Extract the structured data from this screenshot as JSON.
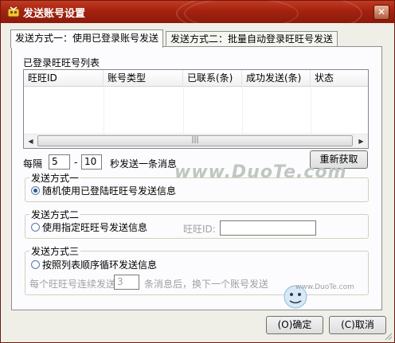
{
  "window": {
    "title": "发送账号设置",
    "close_symbol": "✕"
  },
  "tabs": [
    {
      "label": "发送方式一：使用已登录账号发送",
      "active": true
    },
    {
      "label": "发送方式二：批量自动登录旺旺号发送",
      "active": false
    }
  ],
  "logged_list": {
    "label": "已登录旺旺号列表",
    "columns": [
      "旺旺ID",
      "账号类型",
      "已联系(条)",
      "成功发送(条)",
      "状态"
    ],
    "rows": [],
    "scroll_left": "◀",
    "scroll_right": "▶",
    "thumb_grip": "|||"
  },
  "interval": {
    "prefix": "每隔",
    "from_value": "5",
    "dash": "-",
    "to_value": "10",
    "suffix": "秒发送一条消息"
  },
  "refresh_button": "重新获取",
  "mode1": {
    "title": "发送方式一",
    "option": "随机使用已登陆旺旺号发送信息",
    "checked": true
  },
  "mode2": {
    "title": "发送方式二",
    "option": "使用指定旺旺号发送信息",
    "id_label": "旺旺ID:",
    "id_value": "",
    "checked": false
  },
  "mode3": {
    "title": "发送方式三",
    "option": "按照列表顺序循环发送信息",
    "per_prefix": "每个旺旺号连续发送",
    "per_value": "3",
    "per_suffix": "条消息后，换下一个账号发送",
    "checked": false
  },
  "buttons": {
    "ok": "(O)确定",
    "cancel": "(C)取消"
  },
  "watermarks": {
    "main": "www.DuoTe.com",
    "small": "www.DuoTe.com"
  },
  "colors": {
    "titlebar": "#a3220f",
    "panel": "#fcfcfe",
    "window_bg": "#efefe8"
  }
}
